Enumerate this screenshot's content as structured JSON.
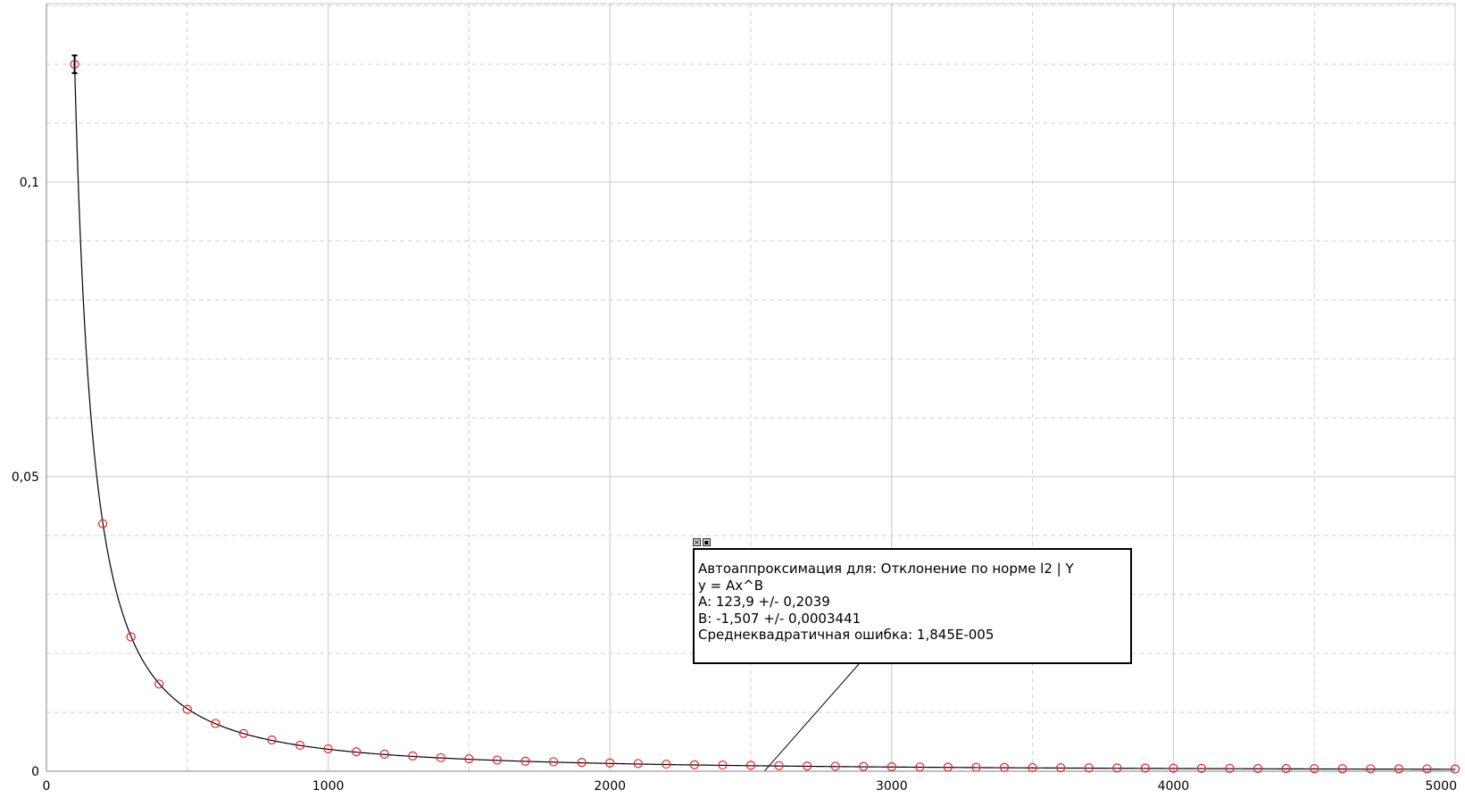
{
  "chart_data": {
    "type": "scatter",
    "x_ticks": [
      "0",
      "1000",
      "2000",
      "3000",
      "4000",
      "5000"
    ],
    "y_ticks": [
      "0",
      "0,05",
      "0,1"
    ],
    "xlim": [
      0,
      5000
    ],
    "ylim": [
      0,
      0.13
    ],
    "grid": true,
    "series": [
      {
        "marker": "circle",
        "color": "#e8202a",
        "x": [
          100,
          200,
          300,
          400,
          500,
          600,
          700,
          800,
          900,
          1000,
          1100,
          1200,
          1300,
          1400,
          1500,
          1600,
          1700,
          1800,
          1900,
          2000,
          2100,
          2200,
          2300,
          2400,
          2500,
          2600,
          2700,
          2800,
          2900,
          3000,
          3100,
          3200,
          3300,
          3400,
          3500,
          3600,
          3700,
          3800,
          3900,
          4000,
          4100,
          4200,
          4300,
          4400,
          4500,
          4600,
          4700,
          4800,
          4900,
          5000
        ],
        "y": [
          0.12,
          0.042,
          0.0228,
          0.0148,
          0.0105,
          0.0081,
          0.0064,
          0.0053,
          0.0044,
          0.0038,
          0.0033,
          0.0029,
          0.0026,
          0.0023,
          0.0021,
          0.0019,
          0.0017,
          0.0016,
          0.0015,
          0.0014,
          0.0013,
          0.0012,
          0.0011,
          0.00105,
          0.001,
          0.00094,
          0.00089,
          0.00084,
          0.0008,
          0.00076,
          0.00073,
          0.0007,
          0.00067,
          0.00064,
          0.00061,
          0.00059,
          0.00057,
          0.00055,
          0.00053,
          0.00051,
          0.00049,
          0.00048,
          0.00046,
          0.00045,
          0.00044,
          0.00042,
          0.00041,
          0.0004,
          0.00039,
          0.00038
        ]
      }
    ],
    "fit": {
      "formula": "y = Ax^B",
      "A": 123.9,
      "B": -1.507,
      "x_range": [
        100,
        5000
      ],
      "color": "#000000"
    },
    "error_bar": {
      "x": 100,
      "y_low": 0.1185,
      "y_high": 0.1215
    }
  },
  "annotation": {
    "lines": [
      "Автоаппроксимация для: Отклонение по норме l2 | Y",
      "y = Ax^B",
      "A: 123,9 +/- 0,2039",
      "B: -1,507 +/- 0,0003441",
      "Среднеквадратичная ошибка: 1,845E-005"
    ],
    "pointer_x": 2550,
    "pointer_y": 0.0001
  }
}
